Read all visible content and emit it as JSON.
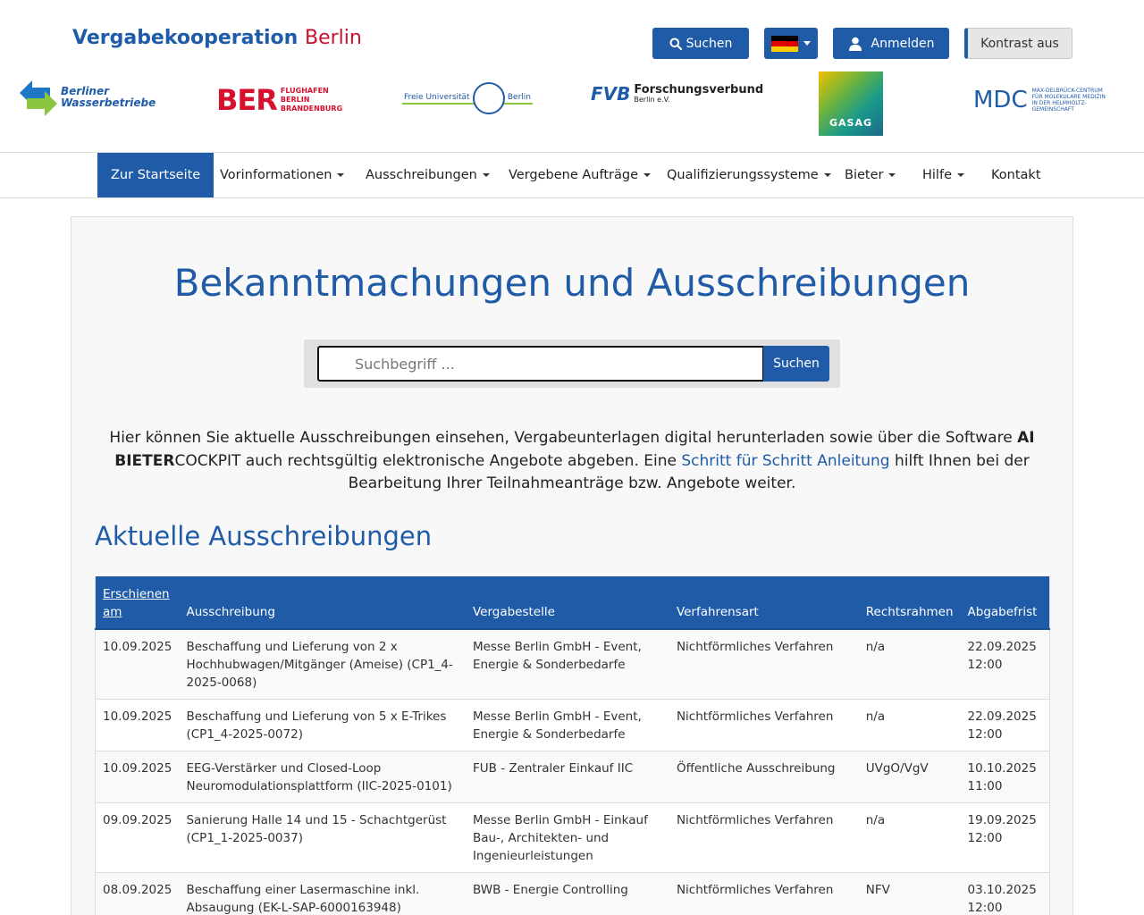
{
  "header": {
    "brand_part1": "Vergabekooperation",
    "brand_part2": "Berlin",
    "search_label": "Suchen",
    "login_label": "Anmelden",
    "contrast_label": "Kontrast aus",
    "flag_colors": [
      "#000000",
      "#dd0000",
      "#ffce00"
    ]
  },
  "logos": {
    "bwb_line1": "Berliner",
    "bwb_line2": "Wasserbetriebe",
    "ber_big": "BER",
    "ber_line1": "FLUGHAFEN",
    "ber_line2": "BERLIN",
    "ber_line3": "BRANDENBURG",
    "fu_left": "Freie Universität",
    "fu_right": "Berlin",
    "fvb_mark": "FVB",
    "fvb_name": "Forschungsverbund",
    "fvb_sub": "Berlin e.V.",
    "gasag": "GASAG",
    "mdc_big": "MDC",
    "mdc_line1": "MAX-DELBRÜCK-CENTRUM",
    "mdc_line2": "FÜR MOLEKULARE MEDIZIN",
    "mdc_line3": "IN DER HELMHOLTZ-GEMEINSCHAFT"
  },
  "nav": {
    "items": [
      {
        "label": "Zur Startseite"
      },
      {
        "label": "Vorinformationen"
      },
      {
        "label": "Ausschreibungen"
      },
      {
        "label": "Vergebene Aufträge"
      },
      {
        "label": "Qualifizierungssysteme"
      },
      {
        "label": "Bieter"
      },
      {
        "label": "Hilfe"
      },
      {
        "label": "Kontakt"
      }
    ]
  },
  "main": {
    "title": "Bekanntmachungen und Ausschreibungen",
    "search_placeholder": "Suchbegriff ...",
    "search_button": "Suchen",
    "intro_part1": "Hier können Sie aktuelle Ausschreibungen einsehen, Vergabeunterlagen digital herunterladen sowie über die Software ",
    "intro_bold": "AI BIETER",
    "intro_part2": "COCKPIT auch rechtsgültig elektronische Angebote abgeben. Eine ",
    "intro_link": "Schritt für Schritt Anleitung",
    "intro_part3": " hilft Ihnen bei der Bearbeitung Ihrer Teilnahmeanträge bzw. Angebote weiter.",
    "section_title": "Aktuelle Ausschreibungen"
  },
  "table": {
    "headers": {
      "date_line1": "Erschienen",
      "date_line2": "am",
      "title": "Ausschreibung",
      "authority": "Vergabestelle",
      "procedure": "Verfahrensart",
      "law": "Rechtsrahmen",
      "deadline": "Abgabefrist"
    },
    "rows": [
      {
        "date": "10.09.2025",
        "title": "Beschaffung und Lieferung von 2 x Hochhubwagen/Mitgänger (Ameise) (CP1_4-2025-0068)",
        "authority": "Messe Berlin GmbH - Event, Energie & Sonderbedarfe",
        "procedure": "Nichtförmliches Verfahren",
        "law": "n/a",
        "deadline_date": "22.09.2025",
        "deadline_time": "12:00"
      },
      {
        "date": "10.09.2025",
        "title": "Beschaffung und Lieferung von 5 x E-Trikes (CP1_4-2025-0072)",
        "authority": "Messe Berlin GmbH - Event, Energie & Sonderbedarfe",
        "procedure": "Nichtförmliches Verfahren",
        "law": "n/a",
        "deadline_date": "22.09.2025",
        "deadline_time": "12:00"
      },
      {
        "date": "10.09.2025",
        "title": "EEG-Verstärker und Closed-Loop Neuromodulationsplattform (IIC-2025-0101)",
        "authority": "FUB - Zentraler Einkauf IIC",
        "procedure": "Öffentliche Ausschreibung",
        "law": "UVgO/VgV",
        "deadline_date": "10.10.2025",
        "deadline_time": "11:00"
      },
      {
        "date": "09.09.2025",
        "title": "Sanierung Halle 14 und 15 - Schachtgerüst (CP1_1-2025-0037)",
        "authority": "Messe Berlin GmbH - Einkauf Bau-, Architekten- und Ingenieurleistungen",
        "procedure": "Nichtförmliches Verfahren",
        "law": "n/a",
        "deadline_date": "19.09.2025",
        "deadline_time": "12:00"
      },
      {
        "date": "08.09.2025",
        "title": "Beschaffung einer Lasermaschine inkl. Absaugung (EK-L-SAP-6000163948)",
        "authority": "BWB - Energie Controlling",
        "procedure": "Nichtförmliches Verfahren",
        "law": "NFV",
        "deadline_date": "03.10.2025",
        "deadline_time": "12:00"
      }
    ]
  }
}
